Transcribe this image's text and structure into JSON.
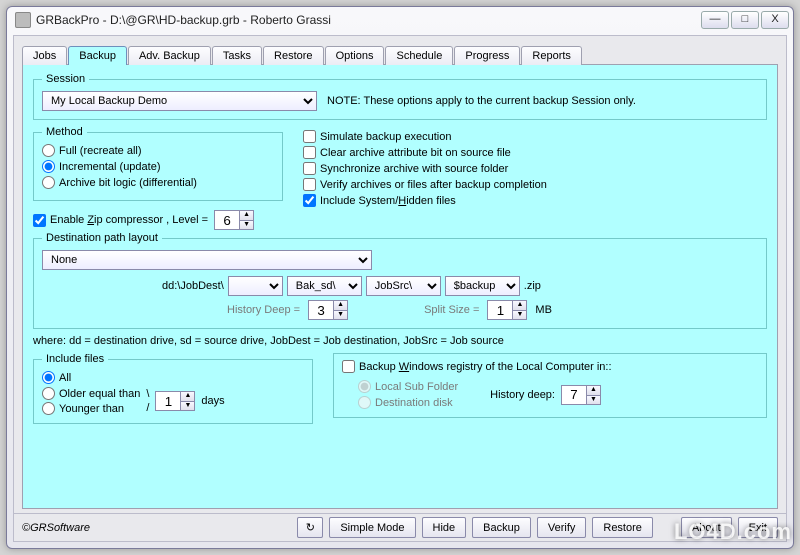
{
  "window": {
    "title": "GRBackPro - D:\\@GR\\HD-backup.grb - Roberto Grassi",
    "buttons": {
      "min": "—",
      "max": "□",
      "close": "X"
    }
  },
  "tabs": [
    "Jobs",
    "Backup",
    "Adv. Backup",
    "Tasks",
    "Restore",
    "Options",
    "Schedule",
    "Progress",
    "Reports"
  ],
  "active_tab": "Backup",
  "session": {
    "legend": "Session",
    "selected": "My Local Backup Demo",
    "note": "NOTE: These options apply to the current backup Session only."
  },
  "method": {
    "legend": "Method",
    "options": {
      "full": "Full (recreate all)",
      "incremental": "Incremental (update)",
      "archive": "Archive bit logic (differential)"
    },
    "selected": "incremental"
  },
  "zip": {
    "enable_label": "Enable Zip compressor , Level =",
    "enabled": true,
    "level": "6"
  },
  "flags": {
    "simulate": {
      "label": "Simulate backup execution",
      "checked": false
    },
    "clear_archive": {
      "label": "Clear archive attribute bit on source file",
      "checked": false
    },
    "sync": {
      "label": "Synchronize archive with source folder",
      "checked": false
    },
    "verify": {
      "label": "Verify archives or files after backup completion",
      "checked": false
    },
    "system_hidden": {
      "label": "Include System/Hidden files",
      "checked": true
    }
  },
  "dest": {
    "legend": "Destination path layout",
    "layout_selected": "None",
    "prefix": "dd:\\JobDest\\",
    "c0": "",
    "c1": "Bak_sd\\",
    "c2": "JobSrc\\",
    "c3": "$backup",
    "ext": ".zip",
    "history_label": "History Deep =",
    "history_value": "3",
    "split_label": "Split Size =",
    "split_value": "1",
    "split_unit": "MB",
    "where": "where: dd = destination drive, sd = source drive, JobDest = Job destination, JobSrc = Job source"
  },
  "include": {
    "legend": "Include files",
    "options": {
      "all": "All",
      "older": "Older equal than",
      "younger": "Younger than"
    },
    "selected": "all",
    "sep": "\\",
    "sep2": "/",
    "days_value": "1",
    "days_unit": "days"
  },
  "registry": {
    "label": "Backup Windows registry of the Local Computer in::",
    "checked": false,
    "options": {
      "local": "Local Sub Folder",
      "dest": "Destination disk"
    },
    "selected": "local",
    "history_label": "History deep:",
    "history_value": "7"
  },
  "footer": {
    "brand": "©GRSoftware",
    "icon": "↻",
    "buttons": [
      "Simple Mode",
      "Hide",
      "Backup",
      "Verify",
      "Restore",
      "About",
      "Exit"
    ]
  },
  "watermark": "LO4D.com"
}
